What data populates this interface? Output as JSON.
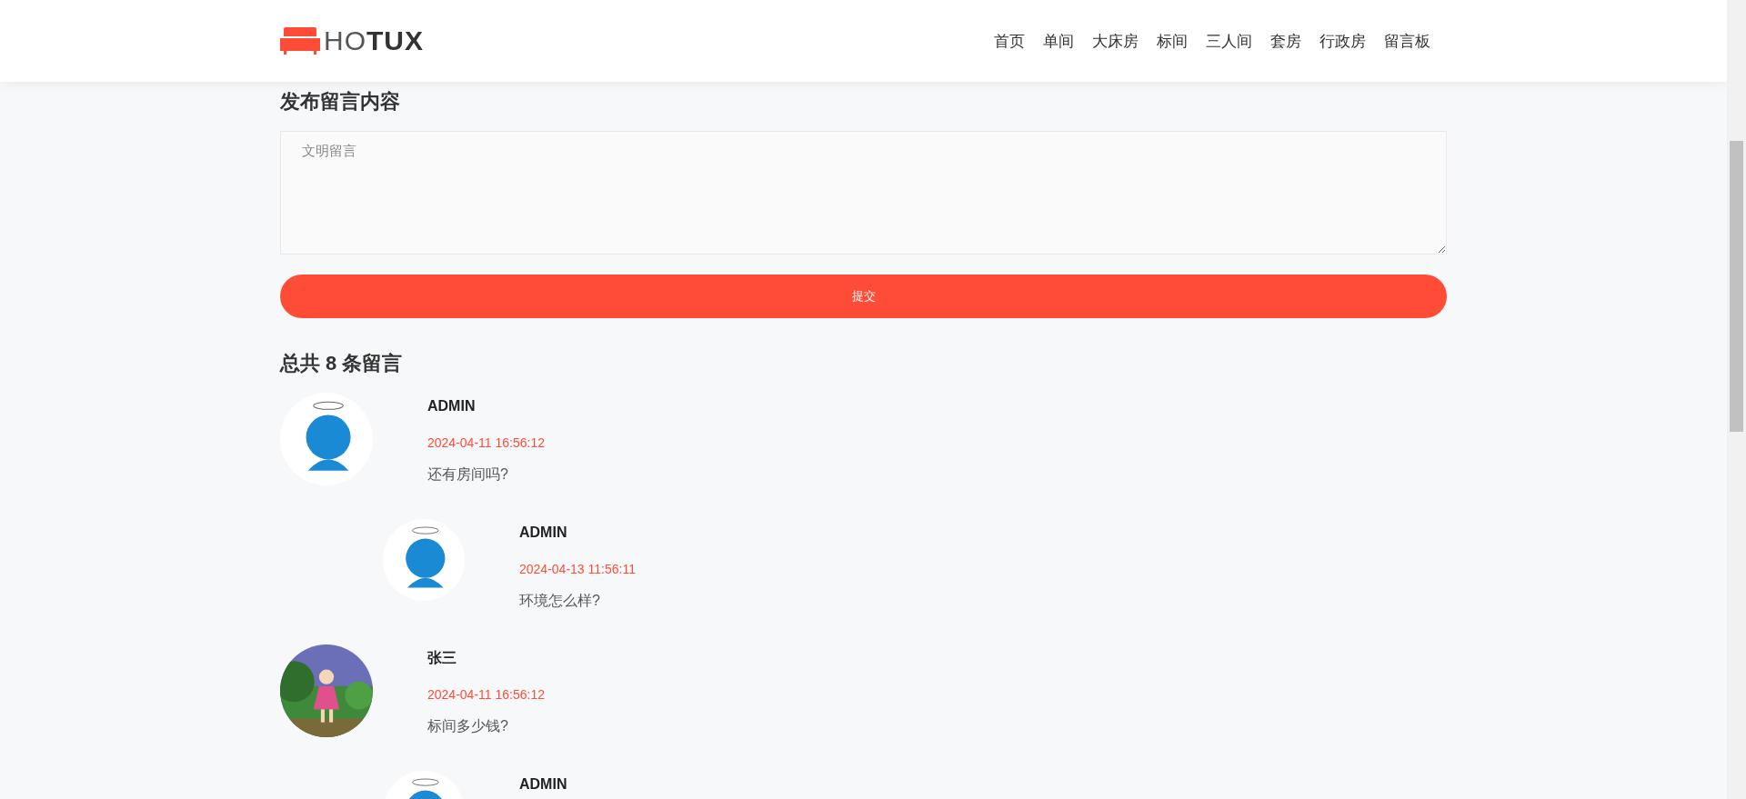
{
  "logo": {
    "text": "HO**TUX**"
  },
  "nav": [
    {
      "label": "首页"
    },
    {
      "label": "单间"
    },
    {
      "label": "大床房"
    },
    {
      "label": "标间"
    },
    {
      "label": "三人间"
    },
    {
      "label": "套房"
    },
    {
      "label": "行政房"
    },
    {
      "label": "留言板"
    }
  ],
  "form": {
    "title": "发布留言内容",
    "placeholder": "文明留言",
    "submit": "提交"
  },
  "count": "总共 8 条留言",
  "comments": [
    {
      "name": "ADMIN",
      "time": "2024-04-11 16:56:12",
      "text": "还有房间吗?",
      "kind": "cartoon",
      "children": [
        {
          "name": "ADMIN",
          "time": "2024-04-13 11:56:11",
          "text": "环境怎么样?",
          "kind": "cartoon"
        }
      ]
    },
    {
      "name": "张三",
      "time": "2024-04-11 16:56:12",
      "text": "标间多少钱?",
      "kind": "picture",
      "children": [
        {
          "name": "ADMIN",
          "kind": "cartoon"
        }
      ]
    }
  ]
}
